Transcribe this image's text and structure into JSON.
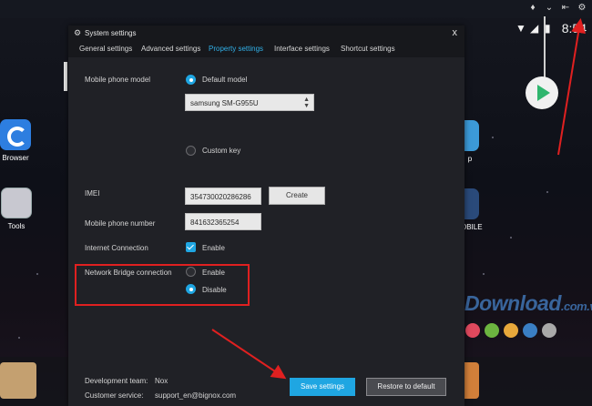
{
  "desktop": {
    "time": "8:54",
    "apps": {
      "browser": "Browser",
      "tools": "Tools",
      "right_partial_1": "p",
      "right_partial_2": "OBILE"
    },
    "topbar_icons": [
      "shirt-icon",
      "chevron-down-icon",
      "pin-icon",
      "gear-icon"
    ],
    "watermark": {
      "main": "Download",
      "suffix": ".com.vn"
    },
    "watermark_dots": [
      "#2ea2d7",
      "#e0495e",
      "#6cb540",
      "#e8a83b",
      "#3a7fc4",
      "#a9a9a9"
    ]
  },
  "dialog": {
    "title": "System settings",
    "close": "x",
    "tabs": [
      {
        "label": "General settings",
        "active": false
      },
      {
        "label": "Advanced settings",
        "active": false
      },
      {
        "label": "Property settings",
        "active": true
      },
      {
        "label": "Interface settings",
        "active": false
      },
      {
        "label": "Shortcut settings",
        "active": false
      }
    ],
    "phone_model": {
      "label": "Mobile phone model",
      "default_option": "Default model",
      "selected_model": "samsung SM-G955U",
      "custom_option": "Custom key"
    },
    "imei": {
      "label": "IMEI",
      "value": "354730020286286",
      "create_button": "Create"
    },
    "phone_number": {
      "label": "Mobile phone number",
      "value": "841632365254"
    },
    "internet": {
      "label": "Internet Connection",
      "option": "Enable"
    },
    "network_bridge": {
      "label": "Network Bridge connection",
      "enable": "Enable",
      "disable": "Disable"
    },
    "footer": {
      "team_label": "Development team:",
      "team_value": "Nox",
      "service_label": "Customer service:",
      "service_value": "support_en@bignox.com",
      "save_button": "Save settings",
      "restore_button": "Restore to default"
    }
  },
  "colors": {
    "accent": "#1fa6e2",
    "active_tab": "#31b0e8",
    "highlight_box": "#e02020",
    "annotation_arrow": "#e02020"
  }
}
